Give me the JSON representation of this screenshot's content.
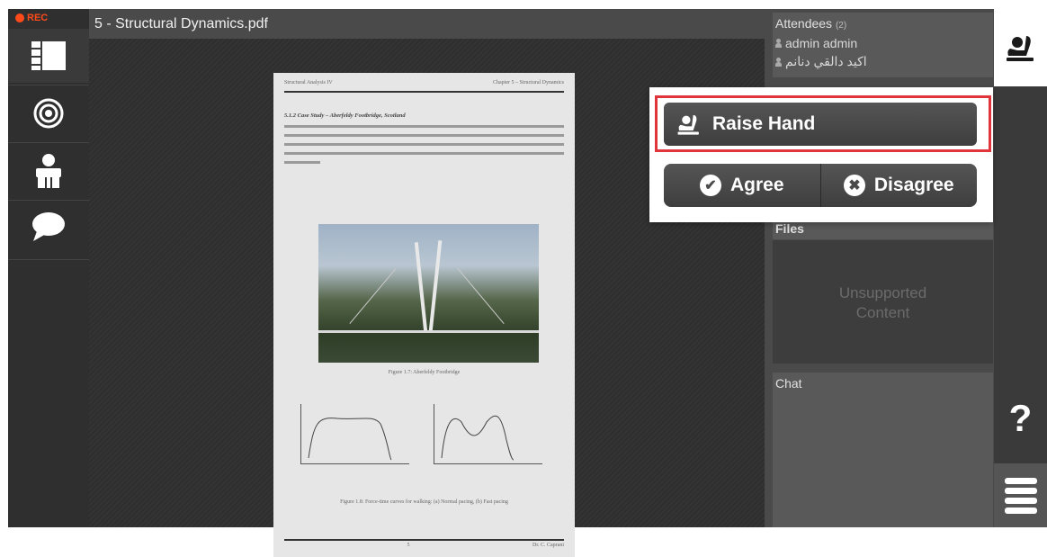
{
  "recording": {
    "label": "REC",
    "color": "#ff4a1a"
  },
  "leftbar": {
    "items": [
      {
        "name": "layout-icon"
      },
      {
        "name": "broadcast-icon"
      },
      {
        "name": "presenter-icon"
      },
      {
        "name": "chat-icon"
      }
    ]
  },
  "document": {
    "title": "5 - Structural Dynamics.pdf",
    "page": {
      "header_left": "Structural Analysis IV",
      "header_right": "Chapter 5 – Structural Dynamics",
      "section_title": "5.1.2  Case Study – Aberfeldy Footbridge, Scotland",
      "figure1_caption": "Figure 1.7: Aberfeldy Footbridge",
      "figure2_caption": "Figure 1.8: Force-time curves for walking: (a) Normal pacing, (b) Fast pacing",
      "footer_left": "5",
      "footer_right": "Dr. C. Caprani"
    }
  },
  "attendees": {
    "title": "Attendees",
    "count": "(2)",
    "list": [
      "admin admin",
      "اكيد دالقي دنانم"
    ]
  },
  "files": {
    "title": "Files",
    "unsupported_line1": "Unsupported",
    "unsupported_line2": "Content"
  },
  "chat": {
    "title": "Chat"
  },
  "popup": {
    "raise_hand": "Raise Hand",
    "agree": "Agree",
    "disagree": "Disagree"
  },
  "farright": {
    "help": "?"
  },
  "colors": {
    "highlight": "#e0353b",
    "panel": "#4a4a4a"
  }
}
